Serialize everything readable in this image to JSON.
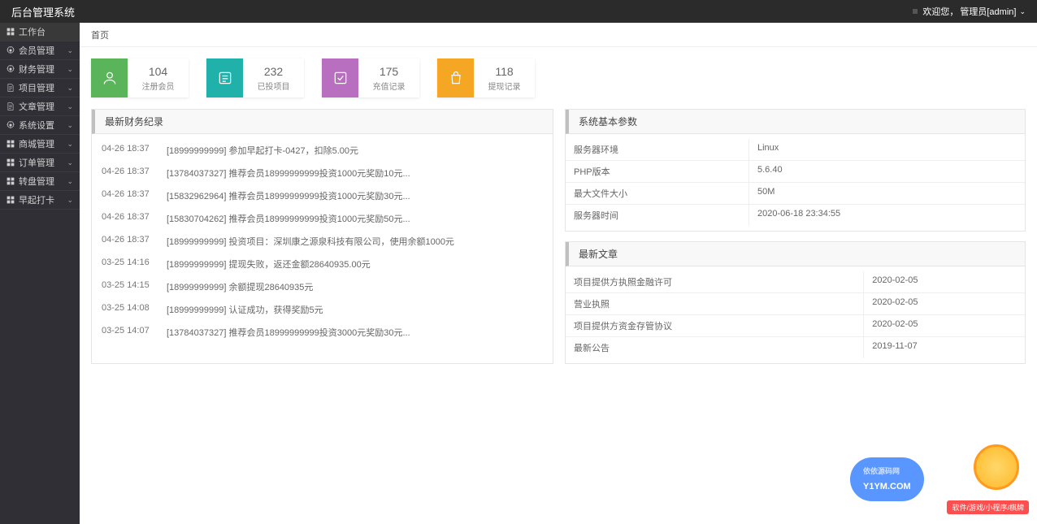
{
  "header": {
    "title": "后台管理系统",
    "welcome": "欢迎您，",
    "role": "管理员[admin]"
  },
  "breadcrumb": "首页",
  "sidebar": {
    "items": [
      {
        "label": "工作台",
        "icon": "grid",
        "expand": false
      },
      {
        "label": "会员管理",
        "icon": "gear",
        "expand": true
      },
      {
        "label": "财务管理",
        "icon": "gear",
        "expand": true
      },
      {
        "label": "项目管理",
        "icon": "doc",
        "expand": true
      },
      {
        "label": "文章管理",
        "icon": "doc",
        "expand": true
      },
      {
        "label": "系统设置",
        "icon": "gear",
        "expand": true
      },
      {
        "label": "商城管理",
        "icon": "grid",
        "expand": true
      },
      {
        "label": "订单管理",
        "icon": "grid",
        "expand": true
      },
      {
        "label": "转盘管理",
        "icon": "grid",
        "expand": true
      },
      {
        "label": "早起打卡",
        "icon": "grid",
        "expand": true
      }
    ]
  },
  "stats": [
    {
      "num": "104",
      "label": "注册会员",
      "color": "bg-green",
      "icon": "user"
    },
    {
      "num": "232",
      "label": "已投项目",
      "color": "bg-teal",
      "icon": "list"
    },
    {
      "num": "175",
      "label": "充值记录",
      "color": "bg-purple",
      "icon": "check"
    },
    {
      "num": "118",
      "label": "提现记录",
      "color": "bg-orange",
      "icon": "bag"
    }
  ],
  "finance": {
    "title": "最新财务纪录",
    "rows": [
      {
        "time": "04-26 18:37",
        "text": "[18999999999] 参加早起打卡-0427，扣除5.00元"
      },
      {
        "time": "04-26 18:37",
        "text": "[13784037327] 推荐会员18999999999投资1000元奖励10元..."
      },
      {
        "time": "04-26 18:37",
        "text": "[15832962964] 推荐会员18999999999投资1000元奖励30元..."
      },
      {
        "time": "04-26 18:37",
        "text": "[15830704262] 推荐会员18999999999投资1000元奖励50元..."
      },
      {
        "time": "04-26 18:37",
        "text": "[18999999999] 投资项目：深圳康之源泉科技有限公司，使用余额1000元"
      },
      {
        "time": "03-25 14:16",
        "text": "[18999999999] 提现失败，返还金额28640935.00元"
      },
      {
        "time": "03-25 14:15",
        "text": "[18999999999] 余额提现28640935元"
      },
      {
        "time": "03-25 14:08",
        "text": "[18999999999] 认证成功，获得奖励5元"
      },
      {
        "time": "03-25 14:07",
        "text": "[13784037327] 推荐会员18999999999投资3000元奖励30元..."
      }
    ]
  },
  "sysinfo": {
    "title": "系统基本参数",
    "rows": [
      {
        "key": "服务器环境",
        "val": "Linux"
      },
      {
        "key": "PHP版本",
        "val": "5.6.40"
      },
      {
        "key": "最大文件大小",
        "val": "50M"
      },
      {
        "key": "服务器时间",
        "val": "2020-06-18 23:34:55"
      }
    ]
  },
  "articles": {
    "title": "最新文章",
    "rows": [
      {
        "key": "项目提供方执照金融许可",
        "val": "2020-02-05"
      },
      {
        "key": "营业执照",
        "val": "2020-02-05"
      },
      {
        "key": "项目提供方资金存管协议",
        "val": "2020-02-05"
      },
      {
        "key": "最新公告",
        "val": "2019-11-07"
      }
    ]
  },
  "watermark": {
    "brand_small": "依依源码网",
    "brand": "Y1YM.COM",
    "tag": "软件/游戏/小程序/棋牌"
  }
}
